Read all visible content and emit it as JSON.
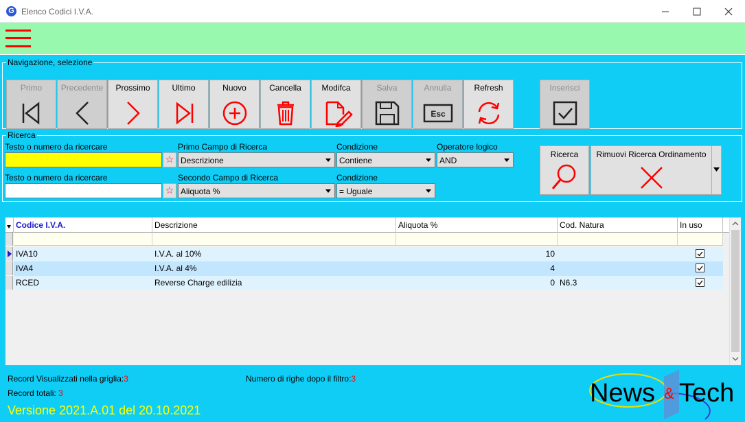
{
  "window": {
    "logo_letter": "G",
    "title": "Elenco Codici I.V.A."
  },
  "nav_group": {
    "title": "Navigazione, selezione",
    "buttons": [
      {
        "label": "Primo",
        "enabled": false,
        "icon": "first-record-icon"
      },
      {
        "label": "Precedente",
        "enabled": false,
        "icon": "previous-record-icon"
      },
      {
        "label": "Prossimo",
        "enabled": true,
        "icon": "next-record-icon"
      },
      {
        "label": "Ultimo",
        "enabled": true,
        "icon": "last-record-icon"
      },
      {
        "label": "Nuovo",
        "enabled": true,
        "icon": "plus-circle-icon"
      },
      {
        "label": "Cancella",
        "enabled": true,
        "icon": "trash-icon"
      },
      {
        "label": "Modifca",
        "enabled": true,
        "icon": "edit-document-icon"
      },
      {
        "label": "Salva",
        "enabled": false,
        "icon": "floppy-disk-icon"
      },
      {
        "label": "Annulla",
        "enabled": false,
        "icon": "esc-key-icon"
      },
      {
        "label": "Refresh",
        "enabled": true,
        "icon": "refresh-icon"
      },
      {
        "label": "Inserisci",
        "enabled": false,
        "icon": "checkbox-icon"
      }
    ],
    "esc_text": "Esc"
  },
  "search_group": {
    "title": "Ricerca",
    "row1": {
      "text_label": "Testo o numero da ricercare",
      "text_value": "",
      "field_label": "Primo Campo di Ricerca",
      "field_value": "Descrizione",
      "condition_label": "Condizione",
      "condition_value": "Contiene",
      "operator_label": "Operatore logico",
      "operator_value": "AND"
    },
    "row2": {
      "text_label": "Testo o numero da ricercare",
      "text_value": "",
      "field_label": "Secondo Campo di Ricerca",
      "field_value": "Aliquota %",
      "condition_label": "Condizione",
      "condition_value": "= Uguale"
    },
    "star_glyph": "☆",
    "search_button": "Ricerca",
    "remove_button": "Rimuovi Ricerca Ordinamento"
  },
  "grid": {
    "columns": [
      "Codice I.V.A.",
      "Descrizione",
      "Aliquota %",
      "Cod. Natura",
      "In uso"
    ],
    "rows": [
      {
        "codice": "IVA10",
        "descrizione": "I.V.A. al 10%",
        "aliquota": "10",
        "natura": "",
        "in_uso": true
      },
      {
        "codice": "IVA4",
        "descrizione": "I.V.A. al 4%",
        "aliquota": "4",
        "natura": "",
        "in_uso": true
      },
      {
        "codice": "RCED",
        "descrizione": "Reverse Charge edilizia",
        "aliquota": "0",
        "natura": "N6.3",
        "in_uso": true
      }
    ]
  },
  "status": {
    "visible_label": "Record Visualizzati nella griglia:",
    "visible_value": "3",
    "filtered_label": "Numero di righe dopo il filtro:",
    "filtered_value": "3",
    "total_label": "Record totali:",
    "total_value": "3",
    "version": "Versione 2021.A.01 del 20.10.2021"
  },
  "brand_logo": {
    "word1": "News",
    "amp": "&",
    "word2": "Tech"
  },
  "colors": {
    "menubar": "#98f9ae",
    "main_bg": "#10cdf6",
    "accent_red": "#ff0000",
    "search_highlight": "#ffff00",
    "row_alt_light": "#dff3ff",
    "row_alt_dark": "#c3e6ff"
  }
}
